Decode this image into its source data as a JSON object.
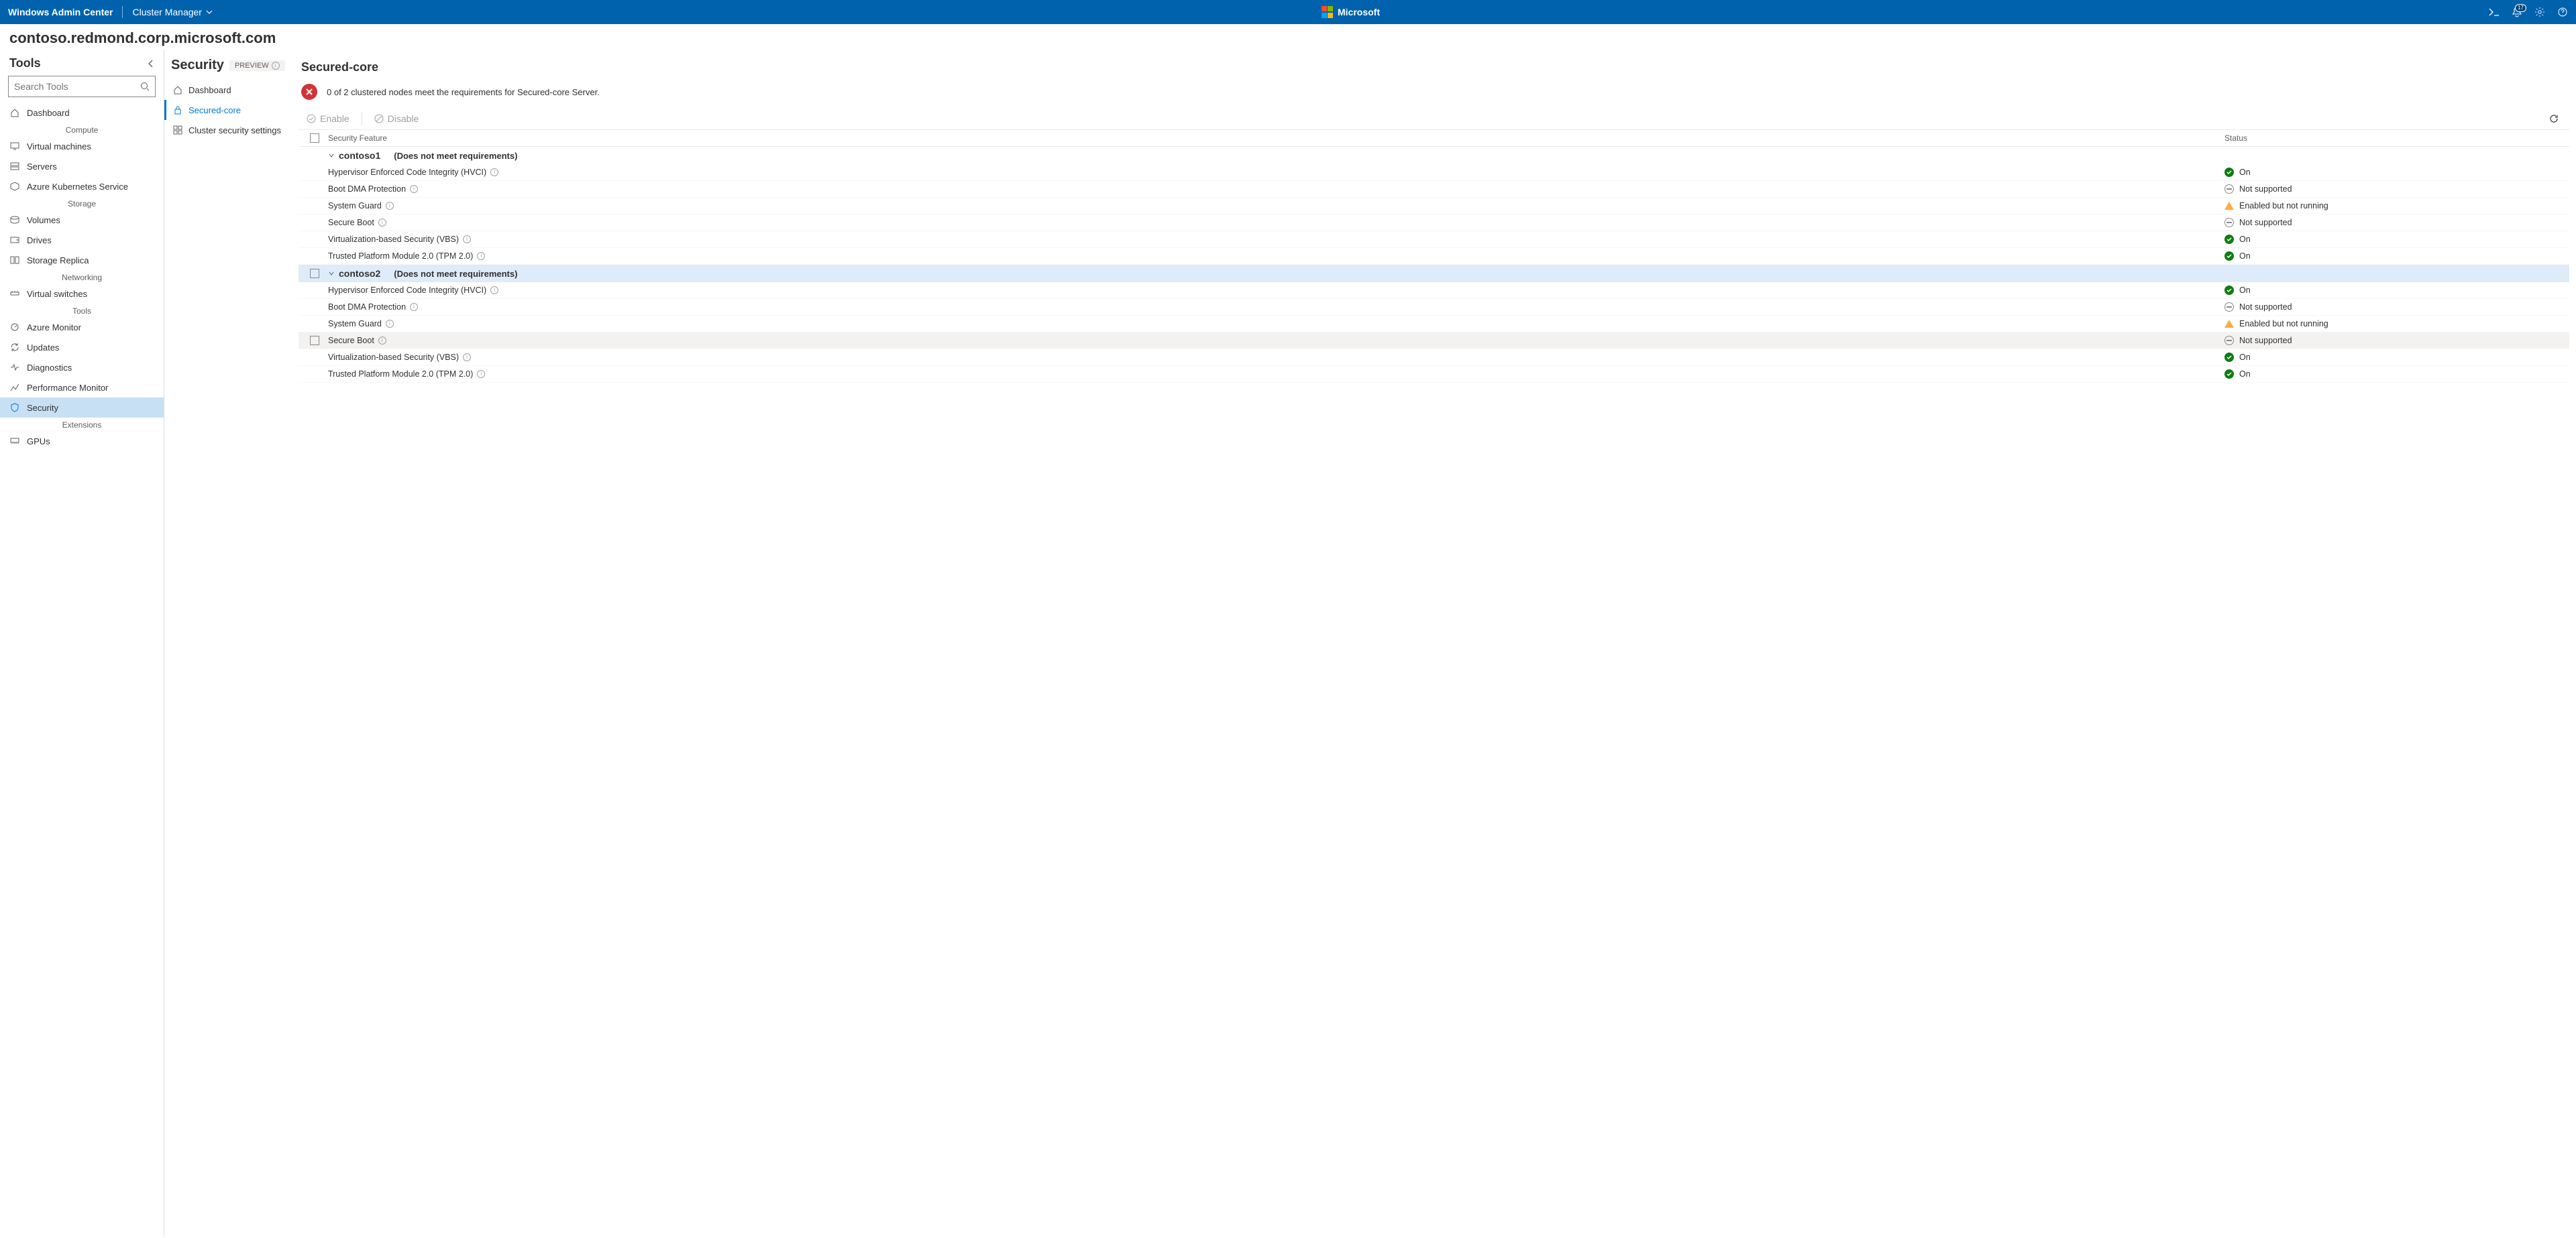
{
  "topbar": {
    "product": "Windows Admin Center",
    "context": "Cluster Manager",
    "brand": "Microsoft",
    "notif_count": "17"
  },
  "connection": "contoso.redmond.corp.microsoft.com",
  "sidebar": {
    "title": "Tools",
    "search_placeholder": "Search Tools",
    "items": [
      {
        "label": "Dashboard"
      },
      {
        "label": "Virtual machines"
      },
      {
        "label": "Servers"
      },
      {
        "label": "Azure Kubernetes Service"
      },
      {
        "label": "Volumes"
      },
      {
        "label": "Drives"
      },
      {
        "label": "Storage Replica"
      },
      {
        "label": "Virtual switches"
      },
      {
        "label": "Azure Monitor"
      },
      {
        "label": "Updates"
      },
      {
        "label": "Diagnostics"
      },
      {
        "label": "Performance Monitor"
      },
      {
        "label": "Security"
      },
      {
        "label": "GPUs"
      }
    ],
    "groups": {
      "compute": "Compute",
      "storage": "Storage",
      "networking": "Networking",
      "tools": "Tools",
      "extensions": "Extensions"
    }
  },
  "subnav": {
    "title": "Security",
    "badge": "PREVIEW",
    "items": [
      {
        "label": "Dashboard"
      },
      {
        "label": "Secured-core"
      },
      {
        "label": "Cluster security settings"
      }
    ]
  },
  "main": {
    "heading": "Secured-core",
    "status_msg": "0 of 2 clustered nodes meet the requirements for Secured-core Server.",
    "toolbar": {
      "enable": "Enable",
      "disable": "Disable"
    },
    "columns": {
      "feature": "Security Feature",
      "status": "Status"
    },
    "status_labels": {
      "on": "On",
      "not_supported": "Not supported",
      "enabled_not_running": "Enabled but not running"
    },
    "nodes": [
      {
        "name": "contoso1",
        "note": "(Does not meet requirements)",
        "features": [
          {
            "name": "Hypervisor Enforced Code Integrity (HVCI)",
            "status": "on"
          },
          {
            "name": "Boot DMA Protection",
            "status": "not_supported"
          },
          {
            "name": "System Guard",
            "status": "enabled_not_running"
          },
          {
            "name": "Secure Boot",
            "status": "not_supported"
          },
          {
            "name": "Virtualization-based Security (VBS)",
            "status": "on"
          },
          {
            "name": "Trusted Platform Module 2.0 (TPM 2.0)",
            "status": "on"
          }
        ]
      },
      {
        "name": "contoso2",
        "note": "(Does not meet requirements)",
        "features": [
          {
            "name": "Hypervisor Enforced Code Integrity (HVCI)",
            "status": "on"
          },
          {
            "name": "Boot DMA Protection",
            "status": "not_supported"
          },
          {
            "name": "System Guard",
            "status": "enabled_not_running"
          },
          {
            "name": "Secure Boot",
            "status": "not_supported"
          },
          {
            "name": "Virtualization-based Security (VBS)",
            "status": "on"
          },
          {
            "name": "Trusted Platform Module 2.0 (TPM 2.0)",
            "status": "on"
          }
        ]
      }
    ]
  }
}
